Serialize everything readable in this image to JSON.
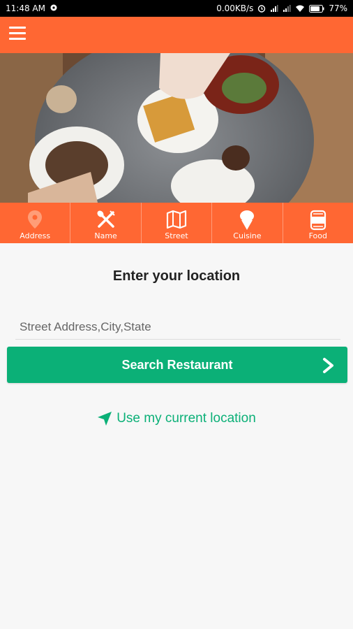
{
  "status_bar": {
    "time": "11:48 AM",
    "network_speed": "0.00KB/s",
    "battery": "77%",
    "icons": [
      "location-pin-icon",
      "alarm-icon",
      "signal-icon",
      "signal-icon",
      "wifi-icon",
      "battery-icon"
    ]
  },
  "toolbar": {
    "menu_icon": "hamburger-menu-icon",
    "color": "#ff6733"
  },
  "hero": {
    "image": "restaurant-table-photo"
  },
  "categories": [
    {
      "label": "Address",
      "icon": "map-pin-icon",
      "active": true
    },
    {
      "label": "Name",
      "icon": "fork-knife-icon",
      "active": false
    },
    {
      "label": "Street",
      "icon": "map-icon",
      "active": false
    },
    {
      "label": "Cuisine",
      "icon": "ice-cream-icon",
      "active": false
    },
    {
      "label": "Food",
      "icon": "food-can-icon",
      "active": false
    }
  ],
  "main": {
    "heading": "Enter your location",
    "search_placeholder": "Street Address,City,State",
    "search_value": "",
    "search_button_label": "Search Restaurant",
    "use_location_label": "Use my current location",
    "accent_color": "#0bb077"
  }
}
